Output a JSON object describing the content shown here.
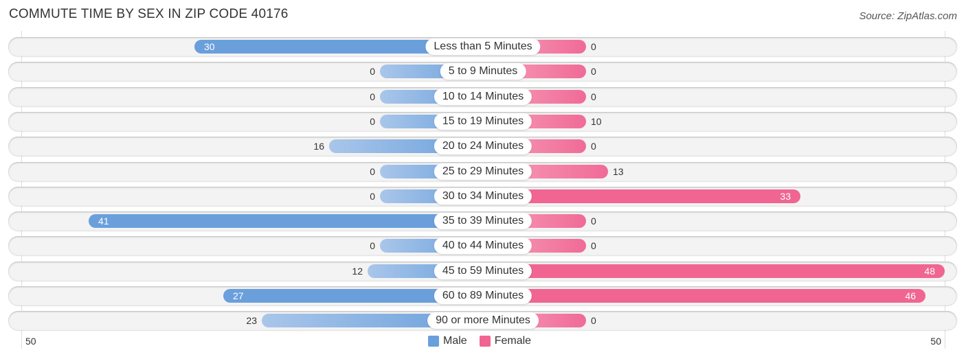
{
  "title": "COMMUTE TIME BY SEX IN ZIP CODE 40176",
  "source": "Source: ZipAtlas.com",
  "colors": {
    "male": "#6a9fdc",
    "female": "#f06592",
    "male_light": "#a9c6ea",
    "female_light": "#f7a1bc"
  },
  "chart_data": {
    "type": "bar",
    "orientation": "horizontal-diverging",
    "title": "COMMUTE TIME BY SEX IN ZIP CODE 40176",
    "categories": [
      "Less than 5 Minutes",
      "5 to 9 Minutes",
      "10 to 14 Minutes",
      "15 to 19 Minutes",
      "20 to 24 Minutes",
      "25 to 29 Minutes",
      "30 to 34 Minutes",
      "35 to 39 Minutes",
      "40 to 44 Minutes",
      "45 to 59 Minutes",
      "60 to 89 Minutes",
      "90 or more Minutes"
    ],
    "series": [
      {
        "name": "Male",
        "values": [
          30,
          0,
          0,
          0,
          16,
          0,
          0,
          41,
          0,
          12,
          27,
          23
        ]
      },
      {
        "name": "Female",
        "values": [
          0,
          0,
          0,
          10,
          0,
          13,
          33,
          0,
          0,
          48,
          46,
          0
        ]
      }
    ],
    "axis": {
      "left_label": "50",
      "right_label": "50",
      "max": 50
    },
    "legend": {
      "position": "bottom-center",
      "items": [
        "Male",
        "Female"
      ]
    }
  }
}
